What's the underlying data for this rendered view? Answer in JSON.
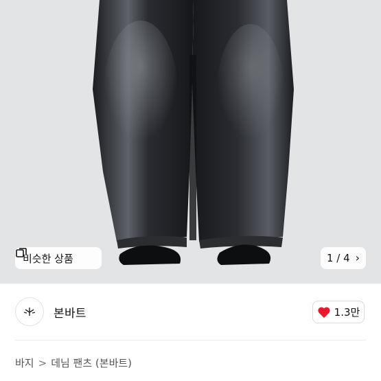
{
  "similar_button": {
    "label": "비슷한 상품",
    "icon": "similar-items-icon"
  },
  "pager": {
    "current": "1",
    "separator": "/",
    "total": "4"
  },
  "seller": {
    "name": "본바트"
  },
  "likes": {
    "count": "1.3만",
    "icon": "heart-icon",
    "color": "#e8192c"
  },
  "breadcrumb": {
    "items": [
      "바지",
      "데님 팬츠 (본바트)"
    ],
    "separator": ">"
  },
  "colors": {
    "image_bg": "#e3e4e6",
    "denim": "#1c1e22",
    "fade": "#7d8086"
  }
}
